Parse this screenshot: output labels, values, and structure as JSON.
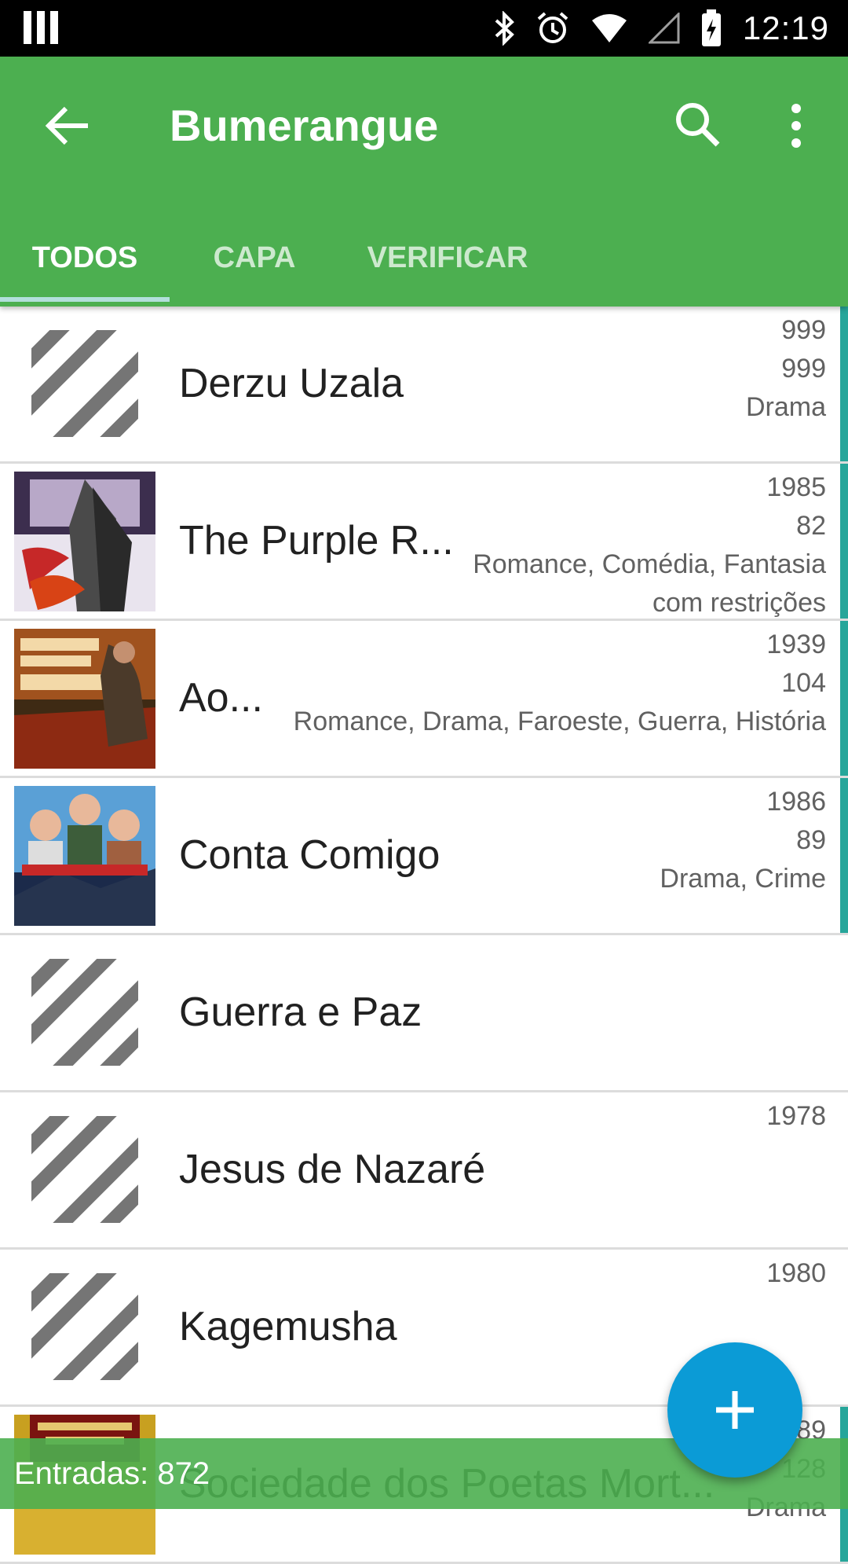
{
  "status_bar": {
    "time": "12:19",
    "icons": [
      "notification-bars-icon",
      "bluetooth-icon",
      "alarm-icon",
      "wifi-icon",
      "signal-icon",
      "battery-charging-icon"
    ]
  },
  "app_bar": {
    "title": "Bumerangue",
    "back_icon": "arrow-back-icon",
    "search_icon": "search-icon",
    "more_icon": "more-vert-icon",
    "color": "#4caf50"
  },
  "tabs": [
    {
      "label": "TODOS",
      "active": true
    },
    {
      "label": "CAPA",
      "active": false
    },
    {
      "label": "VERIFICAR",
      "active": false
    }
  ],
  "list": {
    "items": [
      {
        "title": "Derzu Uzala",
        "year": "999",
        "duration": "999",
        "genres": "Drama",
        "extra": "",
        "has_cover": false
      },
      {
        "title": "The Purple R...",
        "year": "1985",
        "duration": "82",
        "genres": "Romance, Comédia, Fantasia",
        "extra": "com restrições",
        "has_cover": true
      },
      {
        "title": "Ao...",
        "year": "1939",
        "duration": "104",
        "genres": "Romance, Drama, Faroeste, Guerra, História",
        "extra": "",
        "has_cover": true
      },
      {
        "title": "Conta Comigo",
        "year": "1986",
        "duration": "89",
        "genres": "Drama, Crime",
        "extra": "",
        "has_cover": true
      },
      {
        "title": "Guerra e Paz",
        "year": "",
        "duration": "",
        "genres": "",
        "extra": "",
        "has_cover": false
      },
      {
        "title": "Jesus de Nazaré",
        "year": "1978",
        "duration": "",
        "genres": "",
        "extra": "",
        "has_cover": false
      },
      {
        "title": "Kagemusha",
        "year": "1980",
        "duration": "",
        "genres": "",
        "extra": "",
        "has_cover": false
      },
      {
        "title": "Sociedade dos Poetas Mort...",
        "year": "1989",
        "duration": "128",
        "genres": "Drama",
        "extra": "",
        "has_cover": true
      }
    ],
    "accent_color": "#26a69a"
  },
  "footer": {
    "entries_label": "Entradas: 872"
  },
  "fab": {
    "icon": "add-icon",
    "color": "#0b9bd6"
  }
}
